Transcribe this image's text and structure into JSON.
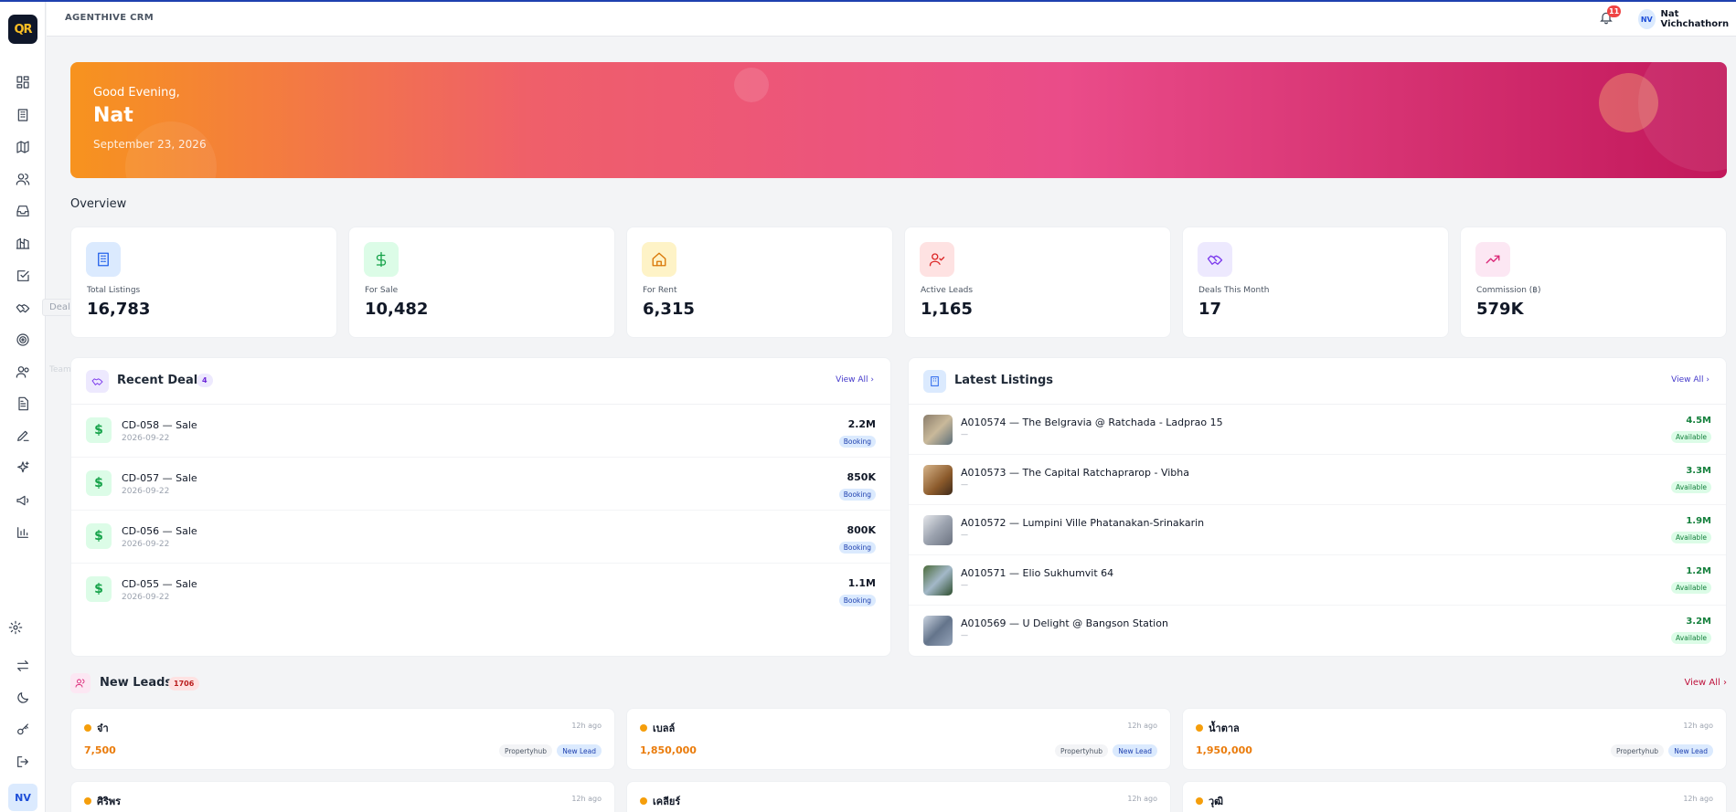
{
  "app": {
    "brand": "AGENTHIVE CRM",
    "logo_text": "QR"
  },
  "topbar": {
    "notification_count": "11",
    "user_initials": "NV",
    "user_name": "Nat Vichchathorn"
  },
  "sidebar": {
    "items": [
      {
        "name": "dashboard",
        "icon": "grid-icon"
      },
      {
        "name": "listings",
        "icon": "building-icon"
      },
      {
        "name": "map",
        "icon": "map-icon"
      },
      {
        "name": "leads",
        "icon": "users-icon"
      },
      {
        "name": "inbox",
        "icon": "inbox-icon"
      },
      {
        "name": "projects",
        "icon": "chart-building-icon"
      },
      {
        "name": "tasks",
        "icon": "check-square-icon"
      },
      {
        "name": "deals",
        "icon": "handshake-icon"
      },
      {
        "name": "targets",
        "icon": "target-icon"
      },
      {
        "name": "team",
        "icon": "team-icon"
      },
      {
        "name": "documents",
        "icon": "file-icon"
      },
      {
        "name": "edit",
        "icon": "pen-icon"
      },
      {
        "name": "ai",
        "icon": "sparkle-icon"
      },
      {
        "name": "marketing",
        "icon": "megaphone-icon"
      },
      {
        "name": "reports",
        "icon": "bar-chart-icon"
      }
    ],
    "tooltip": "Deals",
    "tooltip_faded": "Team",
    "bottom": [
      {
        "name": "settings",
        "icon": "gear-icon"
      },
      {
        "name": "switch",
        "icon": "swap-icon"
      },
      {
        "name": "theme",
        "icon": "moon-icon"
      },
      {
        "name": "keys",
        "icon": "key-icon"
      },
      {
        "name": "logout",
        "icon": "logout-icon"
      }
    ],
    "avatar": "NV"
  },
  "hero": {
    "greeting": "Good Evening,",
    "name": "Nat",
    "date": "September 23, 2026"
  },
  "overview": {
    "title": "Overview"
  },
  "stats": [
    {
      "label": "Total Listings",
      "value": "16,783",
      "icon": "building-icon",
      "bg": "#dbeafe",
      "color": "#2563eb"
    },
    {
      "label": "For Sale",
      "value": "10,482",
      "icon": "dollar-icon",
      "bg": "#dcfce7",
      "color": "#16a34a"
    },
    {
      "label": "For Rent",
      "value": "6,315",
      "icon": "home-icon",
      "bg": "#fef3c7",
      "color": "#d97706"
    },
    {
      "label": "Active Leads",
      "value": "1,165",
      "icon": "user-check-icon",
      "bg": "#fee2e2",
      "color": "#dc2626"
    },
    {
      "label": "Deals This Month",
      "value": "17",
      "icon": "handshake-icon",
      "bg": "#ede9fe",
      "color": "#7c3aed"
    },
    {
      "label": "Commission (฿)",
      "value": "579K",
      "icon": "trending-up-icon",
      "bg": "#fce7f3",
      "color": "#db2777"
    }
  ],
  "recent_deals": {
    "title": "Recent Deals",
    "count": "4",
    "view_all": "View All",
    "items": [
      {
        "title": "CD-058 — Sale",
        "date": "2026-09-22",
        "amount": "2.2M",
        "status": "Booking",
        "icon": "$"
      },
      {
        "title": "CD-057 — Sale",
        "date": "2026-09-22",
        "amount": "850K",
        "status": "Booking",
        "icon": "$"
      },
      {
        "title": "CD-056 — Sale",
        "date": "2026-09-22",
        "amount": "800K",
        "status": "Booking",
        "icon": "$"
      },
      {
        "title": "CD-055 — Sale",
        "date": "2026-09-22",
        "amount": "1.1M",
        "status": "Booking",
        "icon": "$"
      }
    ]
  },
  "latest_listings": {
    "title": "Latest Listings",
    "view_all": "View All",
    "items": [
      {
        "title": "A010574 — The Belgravia @ Ratchada - Ladprao 15",
        "sub": "—",
        "amount": "4.5M",
        "status": "Available"
      },
      {
        "title": "A010573 — The Capital Ratchaprarop - Vibha",
        "sub": "—",
        "amount": "3.3M",
        "status": "Available"
      },
      {
        "title": "A010572 — Lumpini Ville Phatanakan-Srinakarin",
        "sub": "—",
        "amount": "1.9M",
        "status": "Available"
      },
      {
        "title": "A010571 — Elio Sukhumvit 64",
        "sub": "—",
        "amount": "1.2M",
        "status": "Available"
      },
      {
        "title": "A010569 — U Delight @ Bangson Station",
        "sub": "—",
        "amount": "3.2M",
        "status": "Available"
      }
    ]
  },
  "new_leads": {
    "title": "New Leads",
    "count": "1706",
    "view_all": "View All",
    "items": [
      {
        "name": "จ๋า",
        "time": "12h ago",
        "price": "7,500",
        "source": "Propertyhub",
        "status": "New Lead"
      },
      {
        "name": "เบลล์",
        "time": "12h ago",
        "price": "1,850,000",
        "source": "Propertyhub",
        "status": "New Lead"
      },
      {
        "name": "น้ำตาล",
        "time": "12h ago",
        "price": "1,950,000",
        "source": "Propertyhub",
        "status": "New Lead"
      },
      {
        "name": "ศิริพร",
        "time": "12h ago"
      },
      {
        "name": "เคลียร์",
        "time": "12h ago"
      },
      {
        "name": "วุฒิ",
        "time": "12h ago"
      }
    ]
  }
}
